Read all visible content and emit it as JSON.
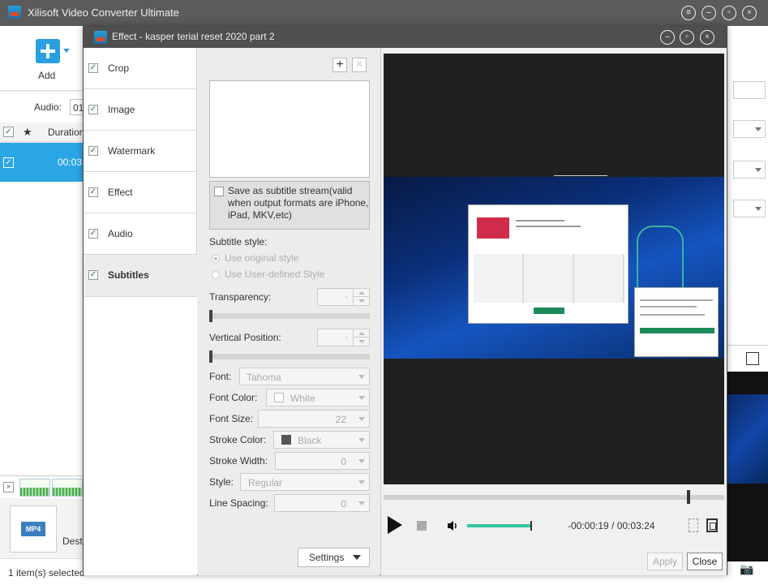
{
  "main_window": {
    "title": "Xilisoft Video Converter Ultimate",
    "toolbar": {
      "add_label": "Add"
    },
    "audio_label": "Audio:",
    "audio_value": "01",
    "list": {
      "duration_header": "Duration",
      "rows": [
        {
          "duration": "00:03:"
        }
      ]
    },
    "destination_label": "Dest",
    "status_text": "1 item(s) selected"
  },
  "dialog": {
    "title": "Effect - kasper terial reset 2020 part 2",
    "sidebar": [
      {
        "label": "Crop",
        "checked": true
      },
      {
        "label": "Image",
        "checked": true
      },
      {
        "label": "Watermark",
        "checked": true
      },
      {
        "label": "Effect",
        "checked": true
      },
      {
        "label": "Audio",
        "checked": true
      },
      {
        "label": "Subtitles",
        "checked": true,
        "active": true
      }
    ],
    "subtitles": {
      "save_stream_label": "Save as subtitle stream(valid when output formats are iPhone, iPad, MKV,etc)",
      "style_label": "Subtitle style:",
      "use_original": "Use original style",
      "use_user_defined": "Use User-defined Style",
      "transparency_label": "Transparency:",
      "vertical_position_label": "Vertical Position:",
      "font_label": "Font:",
      "font_value": "Tahoma",
      "font_color_label": "Font Color:",
      "font_color_value": "White",
      "font_size_label": "Font Size:",
      "font_size_value": "22",
      "stroke_color_label": "Stroke Color:",
      "stroke_color_value": "Black",
      "stroke_width_label": "Stroke Width:",
      "stroke_width_value": "0",
      "style_field_label": "Style:",
      "style_value": "Regular",
      "line_spacing_label": "Line Spacing:",
      "line_spacing_value": "0",
      "settings_button": "Settings"
    },
    "player": {
      "time_display": "-00:00:19 / 00:03:24",
      "seek_fraction": 0.9,
      "volume_fraction": 1.0
    },
    "apply_button": "Apply",
    "close_button": "Close"
  },
  "colors": {
    "selection_blue": "#2aa5e6",
    "volume_teal": "#34c3a3",
    "titlebar": "#4f4f4f"
  }
}
